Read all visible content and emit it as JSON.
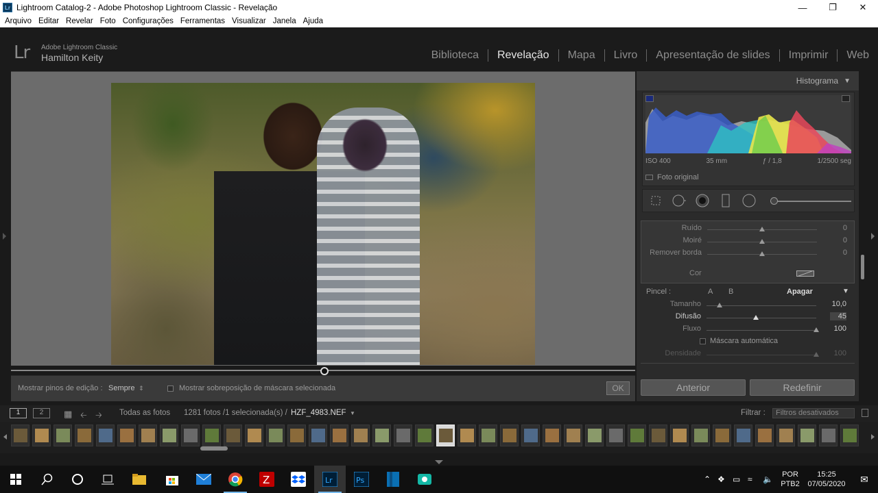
{
  "window": {
    "title": "Lightroom Catalog-2 - Adobe Photoshop Lightroom Classic - Revelação",
    "app_icon": "Lr",
    "minimize_icon": "minimize-icon",
    "maximize_icon": "maximize-icon",
    "close_icon": "close-icon"
  },
  "menu": [
    "Arquivo",
    "Editar",
    "Revelar",
    "Foto",
    "Configurações",
    "Ferramentas",
    "Visualizar",
    "Janela",
    "Ajuda"
  ],
  "identity": {
    "logo": "Lr",
    "product": "Adobe Lightroom Classic",
    "user": "Hamilton Keity"
  },
  "modules": [
    {
      "label": "Biblioteca",
      "active": false
    },
    {
      "label": "Revelação",
      "active": true
    },
    {
      "label": "Mapa",
      "active": false
    },
    {
      "label": "Livro",
      "active": false
    },
    {
      "label": "Apresentação de slides",
      "active": false
    },
    {
      "label": "Imprimir",
      "active": false
    },
    {
      "label": "Web",
      "active": false
    }
  ],
  "histogram": {
    "title": "Histograma",
    "iso": "ISO 400",
    "focal": "35 mm",
    "aperture": "ƒ / 1,8",
    "shutter": "1/2500 seg",
    "original_label": "Foto original"
  },
  "detail": {
    "rows": [
      {
        "label": "Ruído",
        "value": "0",
        "pos": 0.5
      },
      {
        "label": "Moiré",
        "value": "0",
        "pos": 0.5
      },
      {
        "label": "Remover borda",
        "value": "0",
        "pos": 0.5
      }
    ],
    "cor_label": "Cor"
  },
  "brush": {
    "label": "Pincel :",
    "a": "A",
    "b": "B",
    "erase": "Apagar",
    "rows": [
      {
        "label": "Tamanho",
        "value": "10,0",
        "pos": 0.12
      },
      {
        "label": "Difusão",
        "value": "45",
        "pos": 0.45
      },
      {
        "label": "Fluxo",
        "value": "100",
        "pos": 1.0
      }
    ],
    "auto_mask": "Máscara automática",
    "density_label": "Densidade",
    "density_value": "100"
  },
  "toolbar": {
    "pins_label": "Mostrar pinos de edição :",
    "pins_value": "Sempre",
    "overlay_label": "Mostrar sobreposição de máscara selecionada",
    "ok": "OK"
  },
  "buttons": {
    "previous": "Anterior",
    "reset": "Redefinir"
  },
  "filmstrip": {
    "view1": "1",
    "view2": "2",
    "source": "Todas as fotos",
    "count": "1281 fotos /1 selecionada(s) /",
    "filename": "HZF_4983.NEF",
    "filter_label": "Filtrar :",
    "filter_value": "Filtros desativados",
    "selected_index": 20
  },
  "taskbar": {
    "lang1": "POR",
    "lang2": "PTB2",
    "time": "15:25",
    "date": "07/05/2020"
  },
  "colors": {
    "accent": "#76b9ed",
    "panel": "#2b2b2b",
    "bg": "#1a1a1a"
  }
}
